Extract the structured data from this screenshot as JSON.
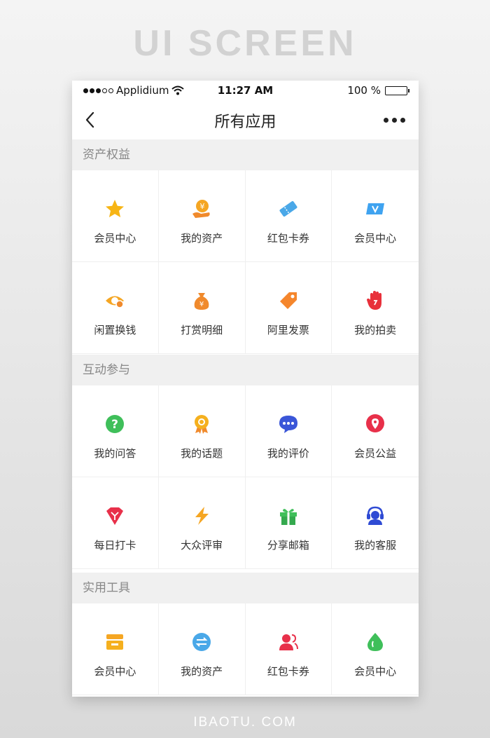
{
  "banner": "UI SCREEN",
  "footer": "IBAOTU. COM",
  "status_bar": {
    "carrier": "Applidium",
    "time": "11:27 AM",
    "battery": "100 %"
  },
  "nav": {
    "title": "所有应用"
  },
  "sections": [
    {
      "title": "资产权益",
      "items": [
        {
          "label": "会员中心",
          "icon": "star-icon",
          "color": "#f7b515"
        },
        {
          "label": "我的资产",
          "icon": "hand-coin-icon",
          "color": "#f5a623"
        },
        {
          "label": "红包卡券",
          "icon": "ticket-icon",
          "color": "#4aa8e8"
        },
        {
          "label": "会员中心",
          "icon": "vip-card-icon",
          "color": "#3fa3f0"
        },
        {
          "label": "闲置换钱",
          "icon": "eye-coin-icon",
          "color": "#f5a623"
        },
        {
          "label": "打赏明细",
          "icon": "money-bag-icon",
          "color": "#f08a2c"
        },
        {
          "label": "阿里发票",
          "icon": "tag-icon",
          "color": "#f5862c"
        },
        {
          "label": "我的拍卖",
          "icon": "auction-hand-icon",
          "color": "#e8303a"
        }
      ]
    },
    {
      "title": "互动参与",
      "items": [
        {
          "label": "我的问答",
          "icon": "question-icon",
          "color": "#3fbf5a"
        },
        {
          "label": "我的话题",
          "icon": "medal-icon",
          "color": "#f5b01e"
        },
        {
          "label": "我的评价",
          "icon": "chat-bubble-icon",
          "color": "#3a56d8"
        },
        {
          "label": "会员公益",
          "icon": "location-pin-icon",
          "color": "#e8304a"
        },
        {
          "label": "每日打卡",
          "icon": "diamond-icon",
          "color": "#e8304a"
        },
        {
          "label": "大众评审",
          "icon": "lightning-icon",
          "color": "#f5a623"
        },
        {
          "label": "分享邮箱",
          "icon": "gift-icon",
          "color": "#3fbf5a"
        },
        {
          "label": "我的客服",
          "icon": "headset-icon",
          "color": "#2f4bd4"
        }
      ]
    },
    {
      "title": "实用工具",
      "items": [
        {
          "label": "会员中心",
          "icon": "wallet-icon",
          "color": "#f5a623"
        },
        {
          "label": "我的资产",
          "icon": "exchange-icon",
          "color": "#4aa8e8"
        },
        {
          "label": "红包卡券",
          "icon": "users-icon",
          "color": "#e8304a"
        },
        {
          "label": "会员中心",
          "icon": "drop-icon",
          "color": "#3fbf5a"
        }
      ]
    }
  ]
}
